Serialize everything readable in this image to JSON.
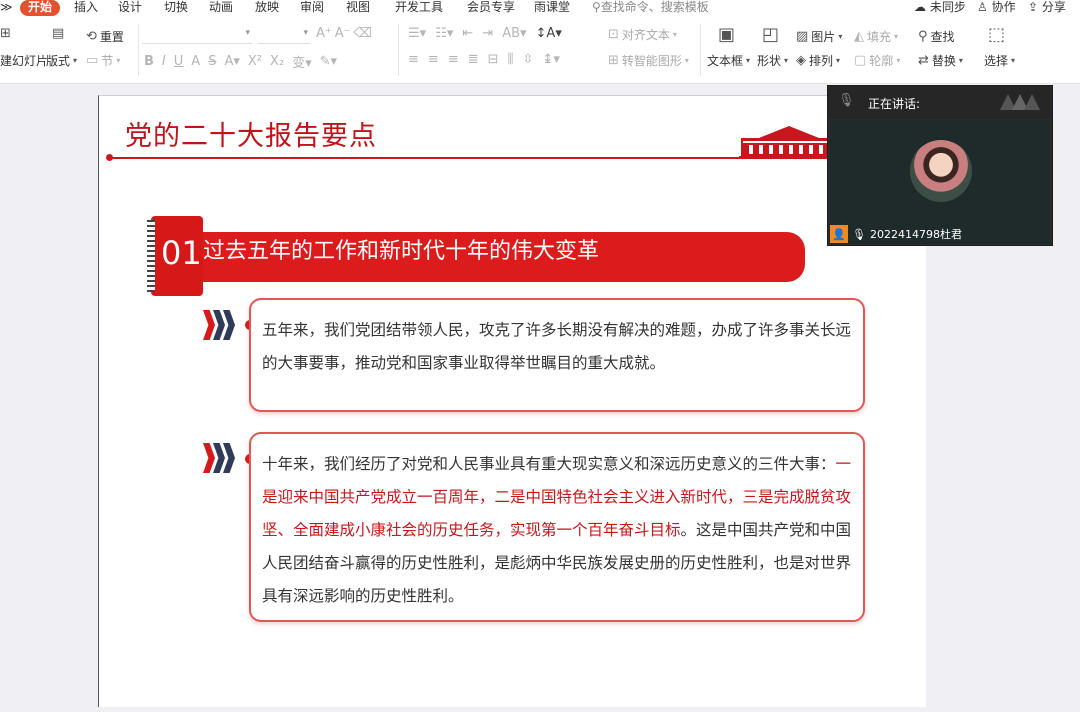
{
  "menubar": {
    "left_partial": "≫",
    "tabs": [
      {
        "label": "开始"
      },
      {
        "label": "插入"
      },
      {
        "label": "设计"
      },
      {
        "label": "切换"
      },
      {
        "label": "动画"
      },
      {
        "label": "放映"
      },
      {
        "label": "审阅"
      },
      {
        "label": "视图"
      },
      {
        "label": "开发工具"
      },
      {
        "label": "会员专享"
      },
      {
        "label": "雨课堂"
      }
    ],
    "search_text": "查找命令、搜索模板",
    "sync_label": "未同步",
    "collab_label": "协作",
    "share_label": "分享"
  },
  "toolbar": {
    "new_slide_label": "建幻灯片",
    "layout_label": "版式",
    "reset_label": "重置",
    "section_label": "节",
    "align_text_label": "对齐文本",
    "smart_shape_label": "转智能图形",
    "textbox_label": "文本框",
    "shape_label": "形状",
    "picture_label": "图片",
    "arrange_label": "排列",
    "fill_label": "填充",
    "outline_label": "轮廓",
    "find_label": "查找",
    "replace_label": "替换",
    "select_label": "选择"
  },
  "slide": {
    "title": "党的二十大报告要点",
    "section_number": "01",
    "section_title": "过去五年的工作和新时代十年的伟大变革",
    "box1_text": "五年来，我们党团结带领人民，攻克了许多长期没有解决的难题，办成了许多事关长远的大事要事，推动党和国家事业取得举世瞩目的重大成就。",
    "box2_part1": "十年来，我们经历了对党和人民事业具有重大现实意义和深远历史意义的三件大事：",
    "box2_red": "一是迎来中国共产党成立一百周年，二是中国特色社会主义进入新时代，三是完成脱贫攻坚、全面建成小康社会的历史任务，实现第一个百年奋斗目标",
    "box2_part2": "。这是中国共产党和中国人民团结奋斗赢得的历史性胜利，是彪炳中华民族发展史册的历史性胜利，也是对世界具有深远影响的历史性胜利。"
  },
  "video": {
    "speaking_label": "正在讲话:",
    "participant_name": "2022414798杜君"
  },
  "colors": {
    "accent": "#e8502d",
    "slide_red": "#c8161d",
    "navy": "#2f3b58"
  }
}
